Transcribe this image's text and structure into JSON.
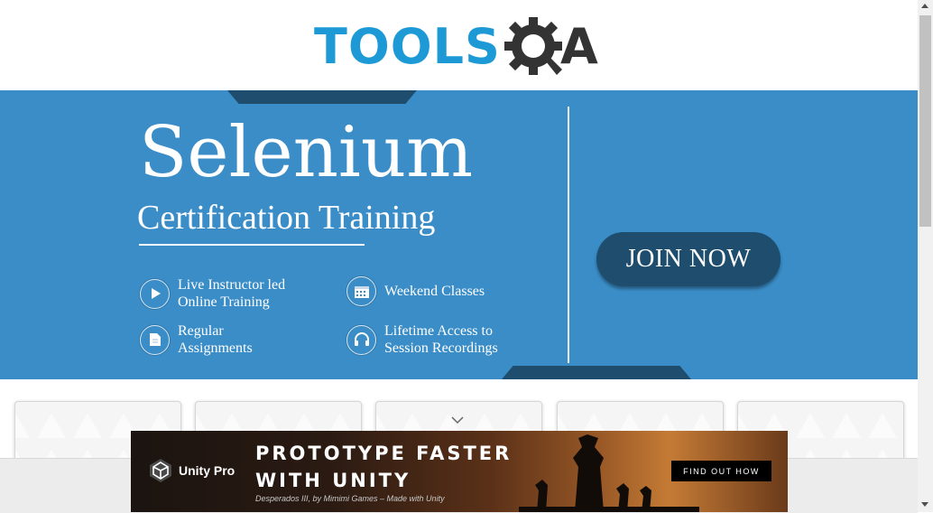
{
  "logo": {
    "text_left": "TOOLS",
    "text_right": "A",
    "icon": "magnifier-gear-icon"
  },
  "banner": {
    "title": "Selenium",
    "subtitle": "Certification Training",
    "features": [
      {
        "line1": "Live Instructor led",
        "line2": "Online Training",
        "icon": "play-icon"
      },
      {
        "line1": "Weekend Classes",
        "line2": "",
        "icon": "calendar-icon"
      },
      {
        "line1": "Regular",
        "line2": "Assignments",
        "icon": "document-icon"
      },
      {
        "line1": "Lifetime Access to",
        "line2": "Session Recordings",
        "icon": "headphones-icon"
      }
    ],
    "cta": "JOIN NOW",
    "colors": {
      "background": "#3a8dc7",
      "accent": "#1f4d6e"
    }
  },
  "ad": {
    "brand": "Unity Pro",
    "headline_line1": "PROTOTYPE FASTER",
    "headline_line2": "WITH UNITY",
    "caption": "Desperados III, by Mimimi Games – Made with Unity",
    "cta": "FIND OUT HOW"
  },
  "colors": {
    "brand_blue": "#1d9ad6",
    "brand_dark": "#333333"
  }
}
